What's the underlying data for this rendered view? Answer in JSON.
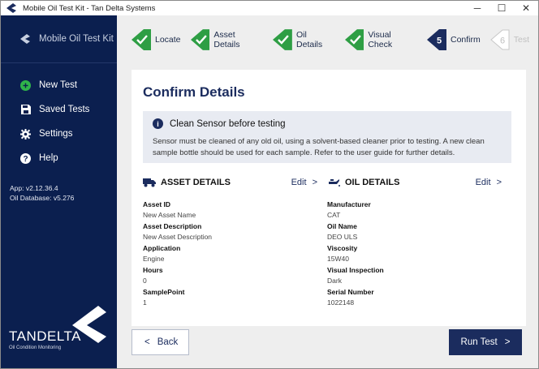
{
  "window": {
    "title": "Mobile Oil Test Kit - Tan Delta Systems",
    "minimize": "─",
    "maximize": "☐",
    "close": "✕"
  },
  "sidebar": {
    "app_name": "Mobile Oil Test Kit",
    "items": [
      {
        "label": "New Test",
        "icon": "plus-circle-icon"
      },
      {
        "label": "Saved Tests",
        "icon": "floppy-disk-icon"
      },
      {
        "label": "Settings",
        "icon": "gear-icon"
      },
      {
        "label": "Help",
        "icon": "question-circle-icon"
      }
    ],
    "app_version": "App: v2.12.36.4",
    "db_version": "Oil Database: v5.276",
    "brand_name": "TANDELTA",
    "brand_tagline": "Oil Condition Monitoring"
  },
  "steps": [
    {
      "label": "Locate",
      "state": "done"
    },
    {
      "label": "Asset Details",
      "state": "done"
    },
    {
      "label": "Oil Details",
      "state": "done"
    },
    {
      "label": "Visual Check",
      "state": "done"
    },
    {
      "label": "Confirm",
      "state": "current",
      "number": "5"
    },
    {
      "label": "Test",
      "state": "disabled",
      "number": "6"
    }
  ],
  "page": {
    "title": "Confirm Details",
    "notice_title": "Clean Sensor before testing",
    "notice_icon": "info-icon",
    "notice_body": "Sensor must be cleaned of any old oil, using a solvent-based cleaner prior to testing. A new clean sample bottle should be used for each sample. Refer to the user guide for further details."
  },
  "asset": {
    "heading": "ASSET DETAILS",
    "edit_label": "Edit",
    "fields": [
      {
        "label": "Asset ID",
        "value": "New Asset Name"
      },
      {
        "label": "Asset Description",
        "value": "New Asset Description"
      },
      {
        "label": "Application",
        "value": "Engine"
      },
      {
        "label": "Hours",
        "value": "0"
      },
      {
        "label": "SamplePoint",
        "value": "1"
      }
    ]
  },
  "oil": {
    "heading": "OIL DETAILS",
    "edit_label": "Edit",
    "fields": [
      {
        "label": "Manufacturer",
        "value": "CAT"
      },
      {
        "label": "Oil Name",
        "value": "DEO ULS"
      },
      {
        "label": "Viscosity",
        "value": "15W40"
      },
      {
        "label": "Visual Inspection",
        "value": "Dark"
      },
      {
        "label": "Serial Number",
        "value": "1022148"
      }
    ]
  },
  "buttons": {
    "back": "Back",
    "run": "Run Test"
  },
  "colors": {
    "navy": "#1b2c5e",
    "sidebar": "#0b1f4f",
    "success": "#2e9e44",
    "new_test_icon": "#2fb34a"
  }
}
